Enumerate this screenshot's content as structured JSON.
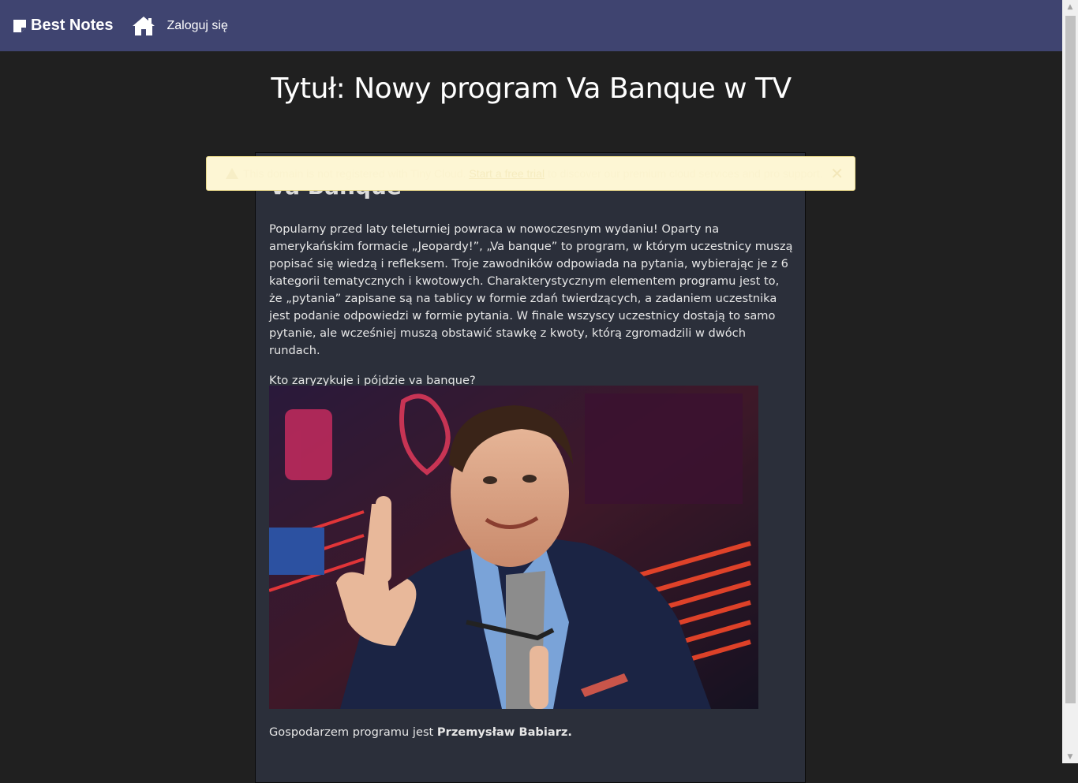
{
  "nav": {
    "brand": "Best Notes",
    "login": "Zaloguj się"
  },
  "page": {
    "title": "Tytuł: Nowy program Va Banque w TV"
  },
  "note": {
    "heading": "Va Banque",
    "paragraph1": "Popularny przed laty teleturniej powraca w nowoczesnym wydaniu! Oparty na amerykańskim formacie „Jeopardy!”, „Va banque” to program, w którym uczestnicy muszą popisać się wiedzą i refleksem. Troje zawodników odpowiada na pytania, wybierając je z 6 kategorii tematycznych i kwotowych. Charakterystycznym elementem programu jest to, że „pytania” zapisane są na tablicy w formie zdań twierdzących, a zadaniem uczestnika jest podanie odpowiedzi w formie pytania. W finale wszyscy uczestnicy dostają to samo pytanie, ale wcześniej muszą obstawić stawkę z kwoty, którą zgromadzili w dwóch rundach.",
    "paragraph2": "Kto zaryzykuje i pójdzie va banque?",
    "host_prefix": "Gospodarzem programu jest ",
    "host_name": "Przemysław Babiarz."
  },
  "notice": {
    "text_before": "This domain is not registered with Tiny Cloud. ",
    "link": "Start a free trial",
    "text_after": " to discover our premium cloud services and pro support.",
    "close": "✕"
  },
  "colors": {
    "navbar": "#3f4470",
    "background": "#202020",
    "card": "#2b2f3a",
    "notice": "#fdf6d4"
  }
}
